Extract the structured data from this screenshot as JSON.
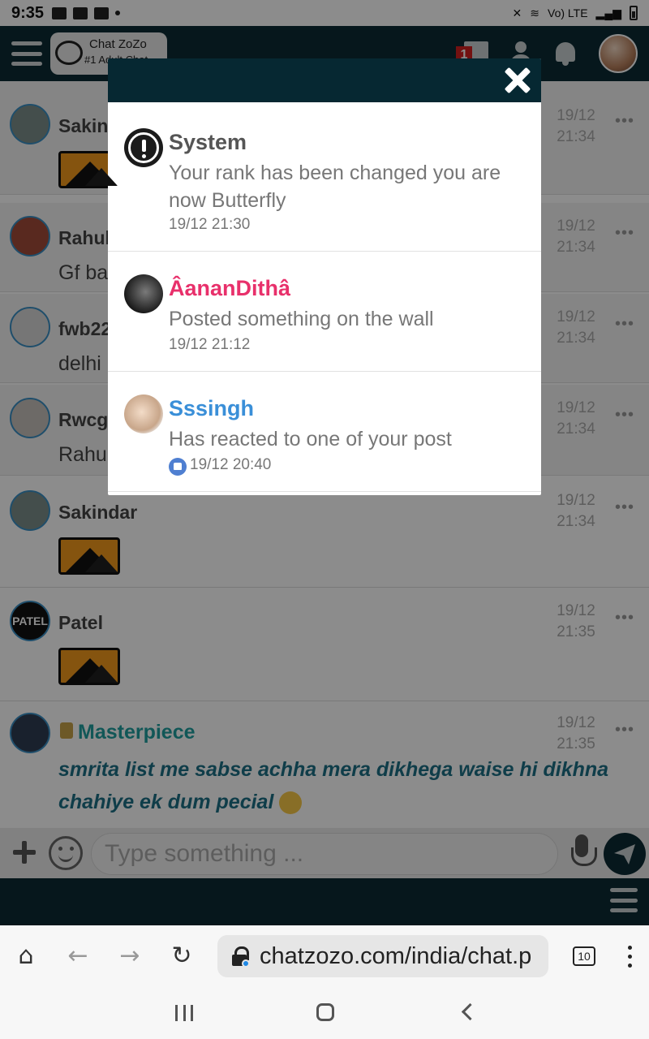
{
  "status_bar": {
    "time": "9:35",
    "network": "Vo) LTE"
  },
  "header": {
    "logo_title": "Chat ZoZo",
    "logo_subtitle": "#1 Adult Chat",
    "news_count": "1"
  },
  "messages": [
    {
      "user": "Sakindar",
      "text": "",
      "time": "19/12\n21:34",
      "has_image": true
    },
    {
      "user": "Rahul",
      "text": "Gf ba",
      "time": "19/12\n21:34",
      "has_image": false
    },
    {
      "user": "fwb22",
      "text": "delhi",
      "time": "19/12\n21:34",
      "has_image": false
    },
    {
      "user": "Rwcg",
      "text": "Rahu",
      "time": "19/12\n21:34",
      "has_image": false
    },
    {
      "user": "Sakindar",
      "text": "",
      "time": "19/12\n21:34",
      "has_image": true
    },
    {
      "user": "Patel",
      "text": "",
      "time": "19/12\n21:35",
      "has_image": true,
      "avatar_text": "PATEL"
    },
    {
      "user": "Masterpiece",
      "text": "smrita list me sabse achha mera dikhega waise hi dikhna chahiye ek dum pecial",
      "time": "19/12\n21:35",
      "has_image": false
    }
  ],
  "composer": {
    "placeholder": "Type something ..."
  },
  "browser": {
    "url": "chatzozo.com/india/chat.p",
    "tab_count": "10"
  },
  "notifications": {
    "items": [
      {
        "name": "System",
        "message": "Your rank has been changed you are now Butterfly",
        "time": "19/12 21:30",
        "name_color": "#555555"
      },
      {
        "name": "ÂananDithâ",
        "message": "Posted something on the wall",
        "time": "19/12 21:12",
        "name_color": "#e8306b"
      },
      {
        "name": "Sssingh",
        "message": "Has reacted to one of your post",
        "time": "19/12 20:40",
        "name_color": "#3a8fd8"
      }
    ]
  },
  "colors": {
    "header_bg": "#0b2a33",
    "modal_head": "#062832",
    "accent_teal": "#1f9f9f"
  }
}
